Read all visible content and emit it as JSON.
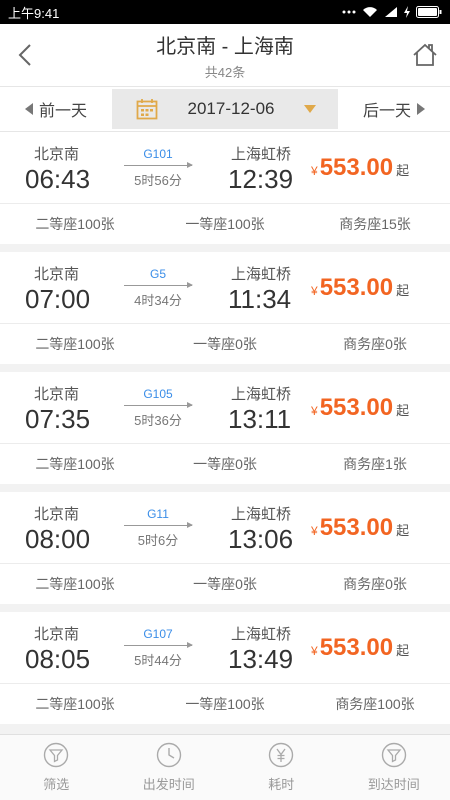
{
  "status_bar": {
    "time": "上午9:41"
  },
  "header": {
    "title": "北京南 - 上海南",
    "subtitle": "共42条"
  },
  "date_bar": {
    "prev_label": "前一天",
    "date": "2017-12-06",
    "next_label": "后一天"
  },
  "trains": [
    {
      "from": "北京南",
      "depart": "06:43",
      "train_no": "G101",
      "duration": "5时56分",
      "to": "上海虹桥",
      "arrive": "12:39",
      "price_symbol": "¥",
      "price": "553.00",
      "price_suffix": "起",
      "seats": [
        "二等座100张",
        "一等座100张",
        "商务座15张"
      ]
    },
    {
      "from": "北京南",
      "depart": "07:00",
      "train_no": "G5",
      "duration": "4时34分",
      "to": "上海虹桥",
      "arrive": "11:34",
      "price_symbol": "¥",
      "price": "553.00",
      "price_suffix": "起",
      "seats": [
        "二等座100张",
        "一等座0张",
        "商务座0张"
      ]
    },
    {
      "from": "北京南",
      "depart": "07:35",
      "train_no": "G105",
      "duration": "5时36分",
      "to": "上海虹桥",
      "arrive": "13:11",
      "price_symbol": "¥",
      "price": "553.00",
      "price_suffix": "起",
      "seats": [
        "二等座100张",
        "一等座0张",
        "商务座1张"
      ]
    },
    {
      "from": "北京南",
      "depart": "08:00",
      "train_no": "G11",
      "duration": "5时6分",
      "to": "上海虹桥",
      "arrive": "13:06",
      "price_symbol": "¥",
      "price": "553.00",
      "price_suffix": "起",
      "seats": [
        "二等座100张",
        "一等座0张",
        "商务座0张"
      ]
    },
    {
      "from": "北京南",
      "depart": "08:05",
      "train_no": "G107",
      "duration": "5时44分",
      "to": "上海虹桥",
      "arrive": "13:49",
      "price_symbol": "¥",
      "price": "553.00",
      "price_suffix": "起",
      "seats": [
        "二等座100张",
        "一等座100张",
        "商务座100张"
      ]
    }
  ],
  "tab_bar": [
    {
      "label": "筛选",
      "icon": "filter-icon"
    },
    {
      "label": "出发时间",
      "icon": "clock-icon"
    },
    {
      "label": "耗时",
      "icon": "yen-icon"
    },
    {
      "label": "到达时间",
      "icon": "filter-icon"
    }
  ],
  "colors": {
    "price": "#f26522",
    "train_no": "#3b8ee8",
    "calendar": "#e0a94a"
  }
}
